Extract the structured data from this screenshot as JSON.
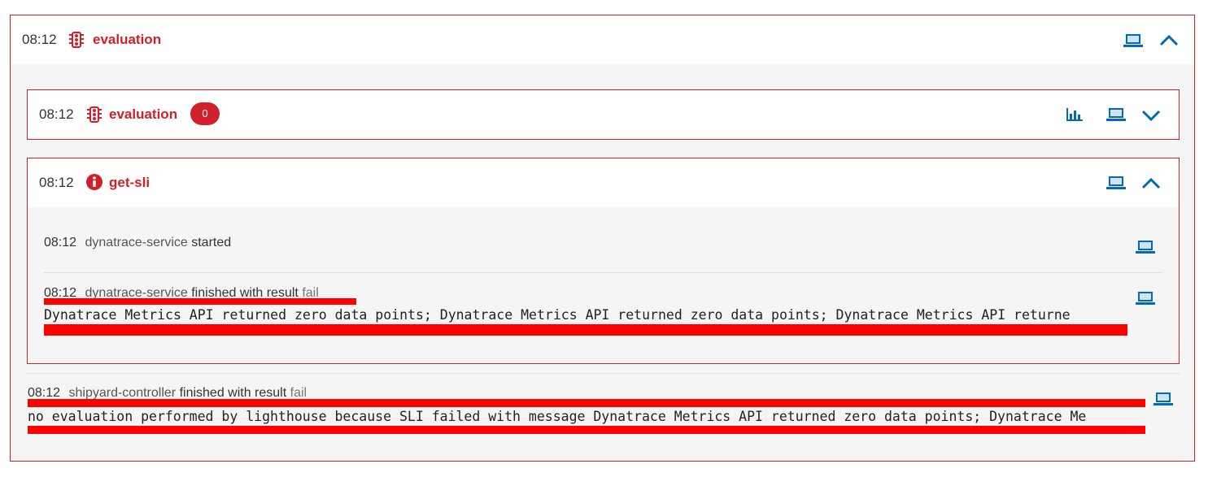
{
  "outer": {
    "time": "08:12",
    "title": "evaluation",
    "icons": [
      "traffic-light-icon",
      "laptop-icon",
      "chevron-up-icon"
    ],
    "colors": {
      "accent": "#d0202a",
      "icon": "#006bb8"
    }
  },
  "evaluation_card": {
    "time": "08:12",
    "title": "evaluation",
    "badge": "0",
    "icons": [
      "traffic-light-icon",
      "bar-chart-icon",
      "laptop-icon",
      "chevron-down-icon"
    ]
  },
  "getsli_card": {
    "time": "08:12",
    "title": "get-sli",
    "icons": [
      "info-circle-icon",
      "laptop-icon",
      "chevron-up-icon"
    ],
    "events": [
      {
        "time": "08:12",
        "service": "dynatrace-service",
        "status": "started"
      },
      {
        "time": "08:12",
        "service": "dynatrace-service",
        "status": "finished with result",
        "result": "fail",
        "message": "Dynatrace Metrics API returned zero data points; Dynatrace Metrics API returned zero data points; Dynatrace Metrics API returne"
      }
    ]
  },
  "shipyard_event": {
    "time": "08:12",
    "service": "shipyard-controller",
    "status": "finished with result",
    "result": "fail",
    "message": "no evaluation performed by lighthouse because SLI failed with message Dynatrace Metrics API returned zero data points; Dynatrace Me"
  }
}
